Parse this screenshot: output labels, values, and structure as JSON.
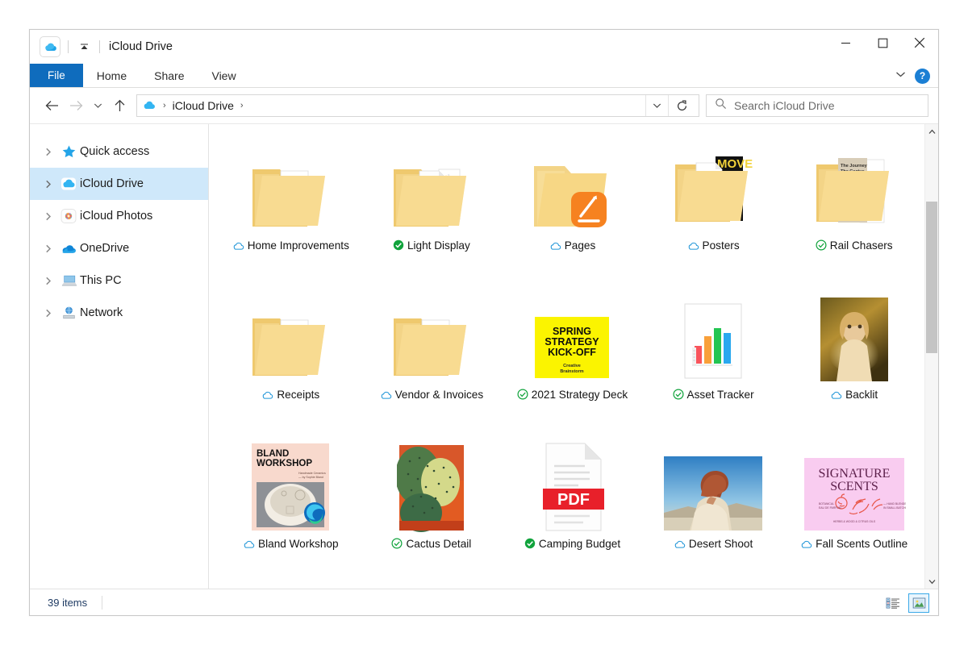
{
  "window": {
    "title": "iCloud Drive",
    "app_icon": "icloud-icon",
    "quick_access_dropdown": "chevron-down-icon",
    "controls": {
      "minimize": "minimize-icon",
      "maximize": "maximize-icon",
      "close": "close-icon"
    }
  },
  "ribbon": {
    "tabs": [
      {
        "label": "File",
        "active": true
      },
      {
        "label": "Home",
        "active": false
      },
      {
        "label": "Share",
        "active": false
      },
      {
        "label": "View",
        "active": false
      }
    ],
    "expand_icon": "chevron-down-icon",
    "help_label": "?"
  },
  "address": {
    "back_icon": "arrow-left-icon",
    "forward_icon": "arrow-right-icon",
    "recent_icon": "chevron-down-icon",
    "up_icon": "arrow-up-icon",
    "breadcrumb_icon": "icloud-icon",
    "breadcrumb": "iCloud Drive",
    "breadcrumb_sep": "›",
    "dropdown_icon": "chevron-down-icon",
    "refresh_icon": "refresh-icon"
  },
  "search": {
    "icon": "search-icon",
    "placeholder": "Search iCloud Drive",
    "value": ""
  },
  "sidebar": {
    "items": [
      {
        "label": "Quick access",
        "icon": "star-icon",
        "selected": false
      },
      {
        "label": "iCloud Drive",
        "icon": "icloud-icon",
        "selected": true
      },
      {
        "label": "iCloud Photos",
        "icon": "photos-icon",
        "selected": false
      },
      {
        "label": "OneDrive",
        "icon": "onedrive-icon",
        "selected": false
      },
      {
        "label": "This PC",
        "icon": "computer-icon",
        "selected": false
      },
      {
        "label": "Network",
        "icon": "network-icon",
        "selected": false
      }
    ]
  },
  "files": [
    {
      "name": "Home Improvements",
      "kind": "folder-docs",
      "status": "cloud"
    },
    {
      "name": "Light Display",
      "kind": "folder-pdf",
      "status": "downloaded-filled"
    },
    {
      "name": "Pages",
      "kind": "folder-pages",
      "status": "cloud"
    },
    {
      "name": "Posters",
      "kind": "folder-poster",
      "status": "cloud"
    },
    {
      "name": "Rail Chasers",
      "kind": "folder-magazine",
      "status": "downloaded-outline"
    },
    {
      "name": "Receipts",
      "kind": "folder-docs",
      "status": "cloud"
    },
    {
      "name": "Vendor & Invoices",
      "kind": "folder-docs",
      "status": "cloud"
    },
    {
      "name": "2021 Strategy Deck",
      "kind": "keynote-yellow",
      "status": "downloaded-outline"
    },
    {
      "name": "Asset Tracker",
      "kind": "numbers-chart",
      "status": "downloaded-outline"
    },
    {
      "name": "Backlit",
      "kind": "photo-backlit",
      "status": "cloud"
    },
    {
      "name": "Bland Workshop",
      "kind": "web-bland",
      "status": "cloud"
    },
    {
      "name": "Cactus Detail",
      "kind": "photo-cactus",
      "status": "downloaded-outline"
    },
    {
      "name": "Camping Budget",
      "kind": "pdf-doc",
      "status": "downloaded-filled"
    },
    {
      "name": "Desert Shoot",
      "kind": "photo-desert",
      "status": "cloud"
    },
    {
      "name": "Fall Scents Outline",
      "kind": "poster-scents",
      "status": "cloud"
    }
  ],
  "thumbnail_text": {
    "strategy_deck": {
      "line1": "SPRING",
      "line2": "STRATEGY",
      "line3": "KICK-OFF",
      "sub1": "Creative",
      "sub2": "Brainstorm"
    },
    "bland_workshop": {
      "line1": "BLAND",
      "line2": "WORKSHOP"
    },
    "fall_scents": {
      "line1": "SIGNATURE",
      "line2": "SCENTS"
    },
    "pdf_label": "PDF",
    "posters_text": "MOVEMENT"
  },
  "statusbar": {
    "item_count": "39 items",
    "details_view_icon": "details-view-icon",
    "large_icons_view_icon": "large-icons-view-icon",
    "active_view": "large-icons"
  },
  "colors": {
    "accent": "#0f6cbd",
    "selection": "#cfe8fa",
    "cloud_badge": "#2196d8",
    "downloaded_badge": "#11a33c",
    "pdf_red": "#e8202a",
    "folder": "#f7d785"
  }
}
